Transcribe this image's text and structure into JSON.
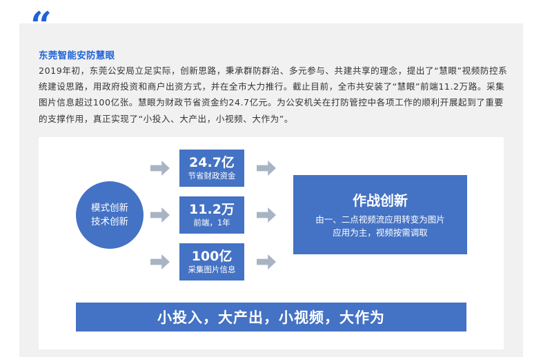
{
  "article": {
    "quote_mark": "“",
    "title": "东莞智能安防慧眼",
    "paragraph": "2019年初，东莞公安局立足实际，创新思路，秉承群防群治、多元参与、共建共享的理念，提出了“慧眼”视频防控系统建设思路，用政府投资和商户出资方式，并在全市大力推行。截止目前，全市共安装了“慧眼”前端11.2万路。采集图片信息超过100亿张。慧眼为财政节省资金约24.7亿元。为公安机关在打防管控中各项工作的顺利开展起到了重要的支撑作用，真正实现了“小投入、大产出，小视频、大作为”。"
  },
  "diagram": {
    "circle": {
      "line1": "模式创新",
      "line2": "技术创新"
    },
    "metrics": [
      {
        "value": "24.7亿",
        "label": "节省财政资金"
      },
      {
        "value": "11.2万",
        "label": "前端，1年"
      },
      {
        "value": "100亿",
        "label": "采集图片信息"
      }
    ],
    "result": {
      "title": "作战创新",
      "line1": "由一、二点视频流应用转变为图片",
      "line2": "应用为主，视频按需调取"
    },
    "banner": "小投入，大产出，小视频，大作为"
  },
  "colors": {
    "accent_blue": "#1f63d6",
    "box_blue": "#4472c4",
    "arrow_gray": "#a8b4c4",
    "panel_gray": "#f1f1f1"
  },
  "icons": {
    "arrow": "right-arrow-icon"
  }
}
